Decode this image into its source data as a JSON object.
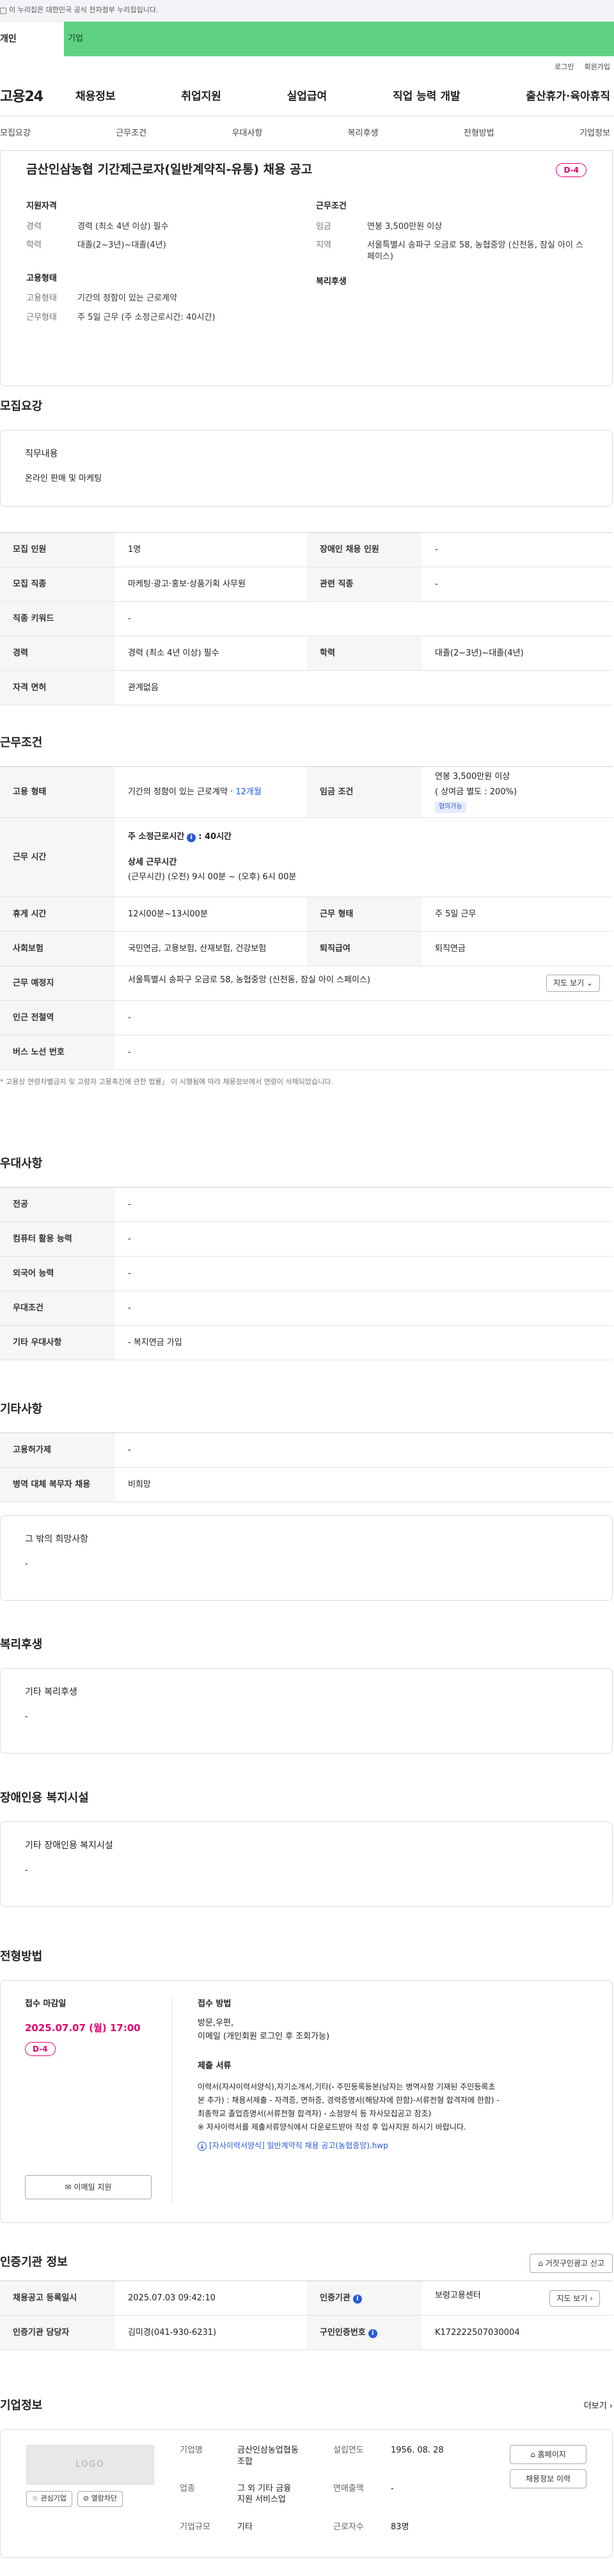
{
  "top_bar": {
    "text": "이 누리집은 대한민국 공식 전자정부 누리집입니다."
  },
  "site_tabs": {
    "personal": "개인",
    "corp": "기업"
  },
  "util_links": [
    "로그인",
    "회원가입"
  ],
  "logo": "고용24",
  "gnb": [
    "채용정보",
    "취업지원",
    "실업급여",
    "직업 능력 개발",
    "출산휴가·육아휴직"
  ],
  "anchors": [
    "모집요강",
    "근무조건",
    "우대사항",
    "복리후생",
    "전형방법",
    "기업정보"
  ],
  "summary": {
    "title": "금산인삼농협 기간제근로자(일반계약직-유통) 채용 공고",
    "dday": "D-4",
    "qualification_title": "지원자격",
    "career_k": "경력",
    "career_v": "경력 (최소 4년 이상) 필수",
    "edu_k": "학력",
    "edu_v": "대졸(2~3년)~대졸(4년)",
    "employ_title": "고용형태",
    "employ_k": "고용형태",
    "employ_v": "기간의 정함이 있는 근로계약",
    "workform_k": "근무형태",
    "workform_v": "주 5일 근무 (주 소정근로시간: 40시간)",
    "cond_title": "근무조건",
    "wage_k": "임금",
    "wage_v": "연봉 3,500만원 이상",
    "region_k": "지역",
    "region_v": "서울특별시 송파구 오금로 58, 농협중앙 (신천동, 잠실 아이 스페이스)",
    "welfare_title": "복리후생"
  },
  "recruit": {
    "title": "모집요강",
    "duty_label": "직무내용",
    "duty_value": "온라인 판매 및 마케팅",
    "rows": [
      [
        "모집 인원",
        "1명",
        "장애인 채용 인원",
        "-"
      ],
      [
        "모집 직종",
        "마케팅·광고·홍보·상품기획 사무원",
        "관련 직종",
        "-"
      ],
      [
        "직종 키워드",
        "-"
      ],
      [
        "경력",
        "경력 (최소 4년 이상) 필수",
        "학력",
        "대졸(2~3년)~대졸(4년)"
      ],
      [
        "자격 면허",
        "관계없음"
      ]
    ]
  },
  "work": {
    "title": "근무조건",
    "emp_k": "고용 형태",
    "emp_v": "기간의 정함이 있는 근로계약 · ",
    "emp_v2": "12개월",
    "wage_k": "임금 조건",
    "wage_v1": "연봉 3,500만원 이상",
    "wage_v2": "( 상여금 별도 : 200%)",
    "wage_tag": "협의가능",
    "time_k": "근무 시간",
    "time_v1": "주 소정근로시간",
    "time_v1b": ": 40시간",
    "time_v2": "상세 근무시간",
    "time_v3": "(근무시간) (오전) 9시 00분 ~ (오후) 6시 00분",
    "rest_k": "휴게 시간",
    "rest_v": "12시00분~13시00분",
    "form_k": "근무 형태",
    "form_v": "주 5일 근무",
    "ins_k": "사회보험",
    "ins_v": "국민연금, 고용보험, 산재보험, 건강보험",
    "ret_k": "퇴직급여",
    "ret_v": "퇴직연금",
    "place_k": "근무 예정지",
    "place_v": "서울특별시 송파구 오금로 58, 농협중앙 (신천동, 잠실 아이 스페이스)",
    "map_btn": "지도 보기 ⌄",
    "subway_k": "인근 전철역",
    "subway_v": "-",
    "bus_k": "버스 노선 번호",
    "bus_v": "-",
    "note": "* 고용상 연령차별금지 및 고령자 고용촉진에 관한 법률」 이 시행됨에 따라 채용정보에서 연령이 삭제되었습니다."
  },
  "pref": {
    "title": "우대사항",
    "rows": [
      [
        "전공",
        "-"
      ],
      [
        "컴퓨터 활용 능력",
        "-"
      ],
      [
        "외국어 능력",
        "-"
      ],
      [
        "우대조건",
        "-"
      ],
      [
        "기타 우대사항",
        "- 복지연금 가입"
      ]
    ]
  },
  "etc": {
    "title": "기타사항",
    "rows": [
      [
        "고용허가제",
        "-"
      ],
      [
        "병역 대체 복무자 채용",
        "비희망"
      ]
    ],
    "box_label": "그 밖의 희망사항",
    "box_value": "-"
  },
  "welfare": {
    "title": "복리후생",
    "box_label": "기타 복리후생",
    "box_value": "-"
  },
  "disabled": {
    "title": "장애인용 복지시설",
    "box_label": "기타 장애인용 복지시설",
    "box_value": "-"
  },
  "process": {
    "title": "전형방법",
    "deadline_label": "접수 마감일",
    "deadline": "2025.07.07 (월) 17:00",
    "dday": "D-4",
    "email_btn": "이메일 지원",
    "method_label": "접수 방법",
    "method_v1": "방문,우편,",
    "method_v2": "이메일 (개인회원 로그인 후 조회가능)",
    "docs_label": "제출 서류",
    "docs_v1": "이력서(자사이력서양식),자기소개서,기타(- 주민등록등본(남자는 병역사항 기재된 주민등록초",
    "docs_v2": "본 추가) : 채용서제출 - 자격증, 면허증, 경력증명서(해당자에 한함)-서류전형 합격자에 한함) -",
    "docs_v3": "최종학교 졸업증명서(서류전형 합격자) - 소정양식 등 자사모집공고 참조)",
    "docs_v4": "※ 자사이력서를 제출서류양식에서 다운로드받아 작성 후 입사지원 하시기 바랍니다.",
    "file": "[자사이력서양식] 일반계약직 채용 공고(농협중앙).hwp"
  },
  "cert": {
    "title": "인증기관 정보",
    "report_btn": "거짓구인광고 신고",
    "reg_k": "채용공고 등록일시",
    "reg_v": "2025.07.03 09:42:10",
    "org_k": "인증기관",
    "org_v": "보령고용센터",
    "map_btn": "지도 보기 ›",
    "mgr_k": "인증기관 담당자",
    "mgr_v": "김미경(041-930-6231)",
    "num_k": "구인인증번호",
    "num_v": "K172222507030004"
  },
  "company": {
    "title": "기업정보",
    "more": "더보기 ›",
    "logo": "LOGO",
    "fav_btn": "관심기업",
    "block_btn": "열람차단",
    "name_k": "기업명",
    "name_v1": "금산인삼농업협동",
    "name_v2": "조합",
    "ind_k": "업종",
    "ind_v1": "그 외 기타 금융",
    "ind_v2": "지원 서비스업",
    "size_k": "기업규모",
    "size_v": "기타",
    "est_k": "설립연도",
    "est_v": "1956. 08. 28",
    "sales_k": "연매출액",
    "sales_v": "-",
    "emp_k": "근로자수",
    "emp_v": "83명",
    "home_btn": "홈페이지",
    "list_btn": "채용정보 이력"
  }
}
